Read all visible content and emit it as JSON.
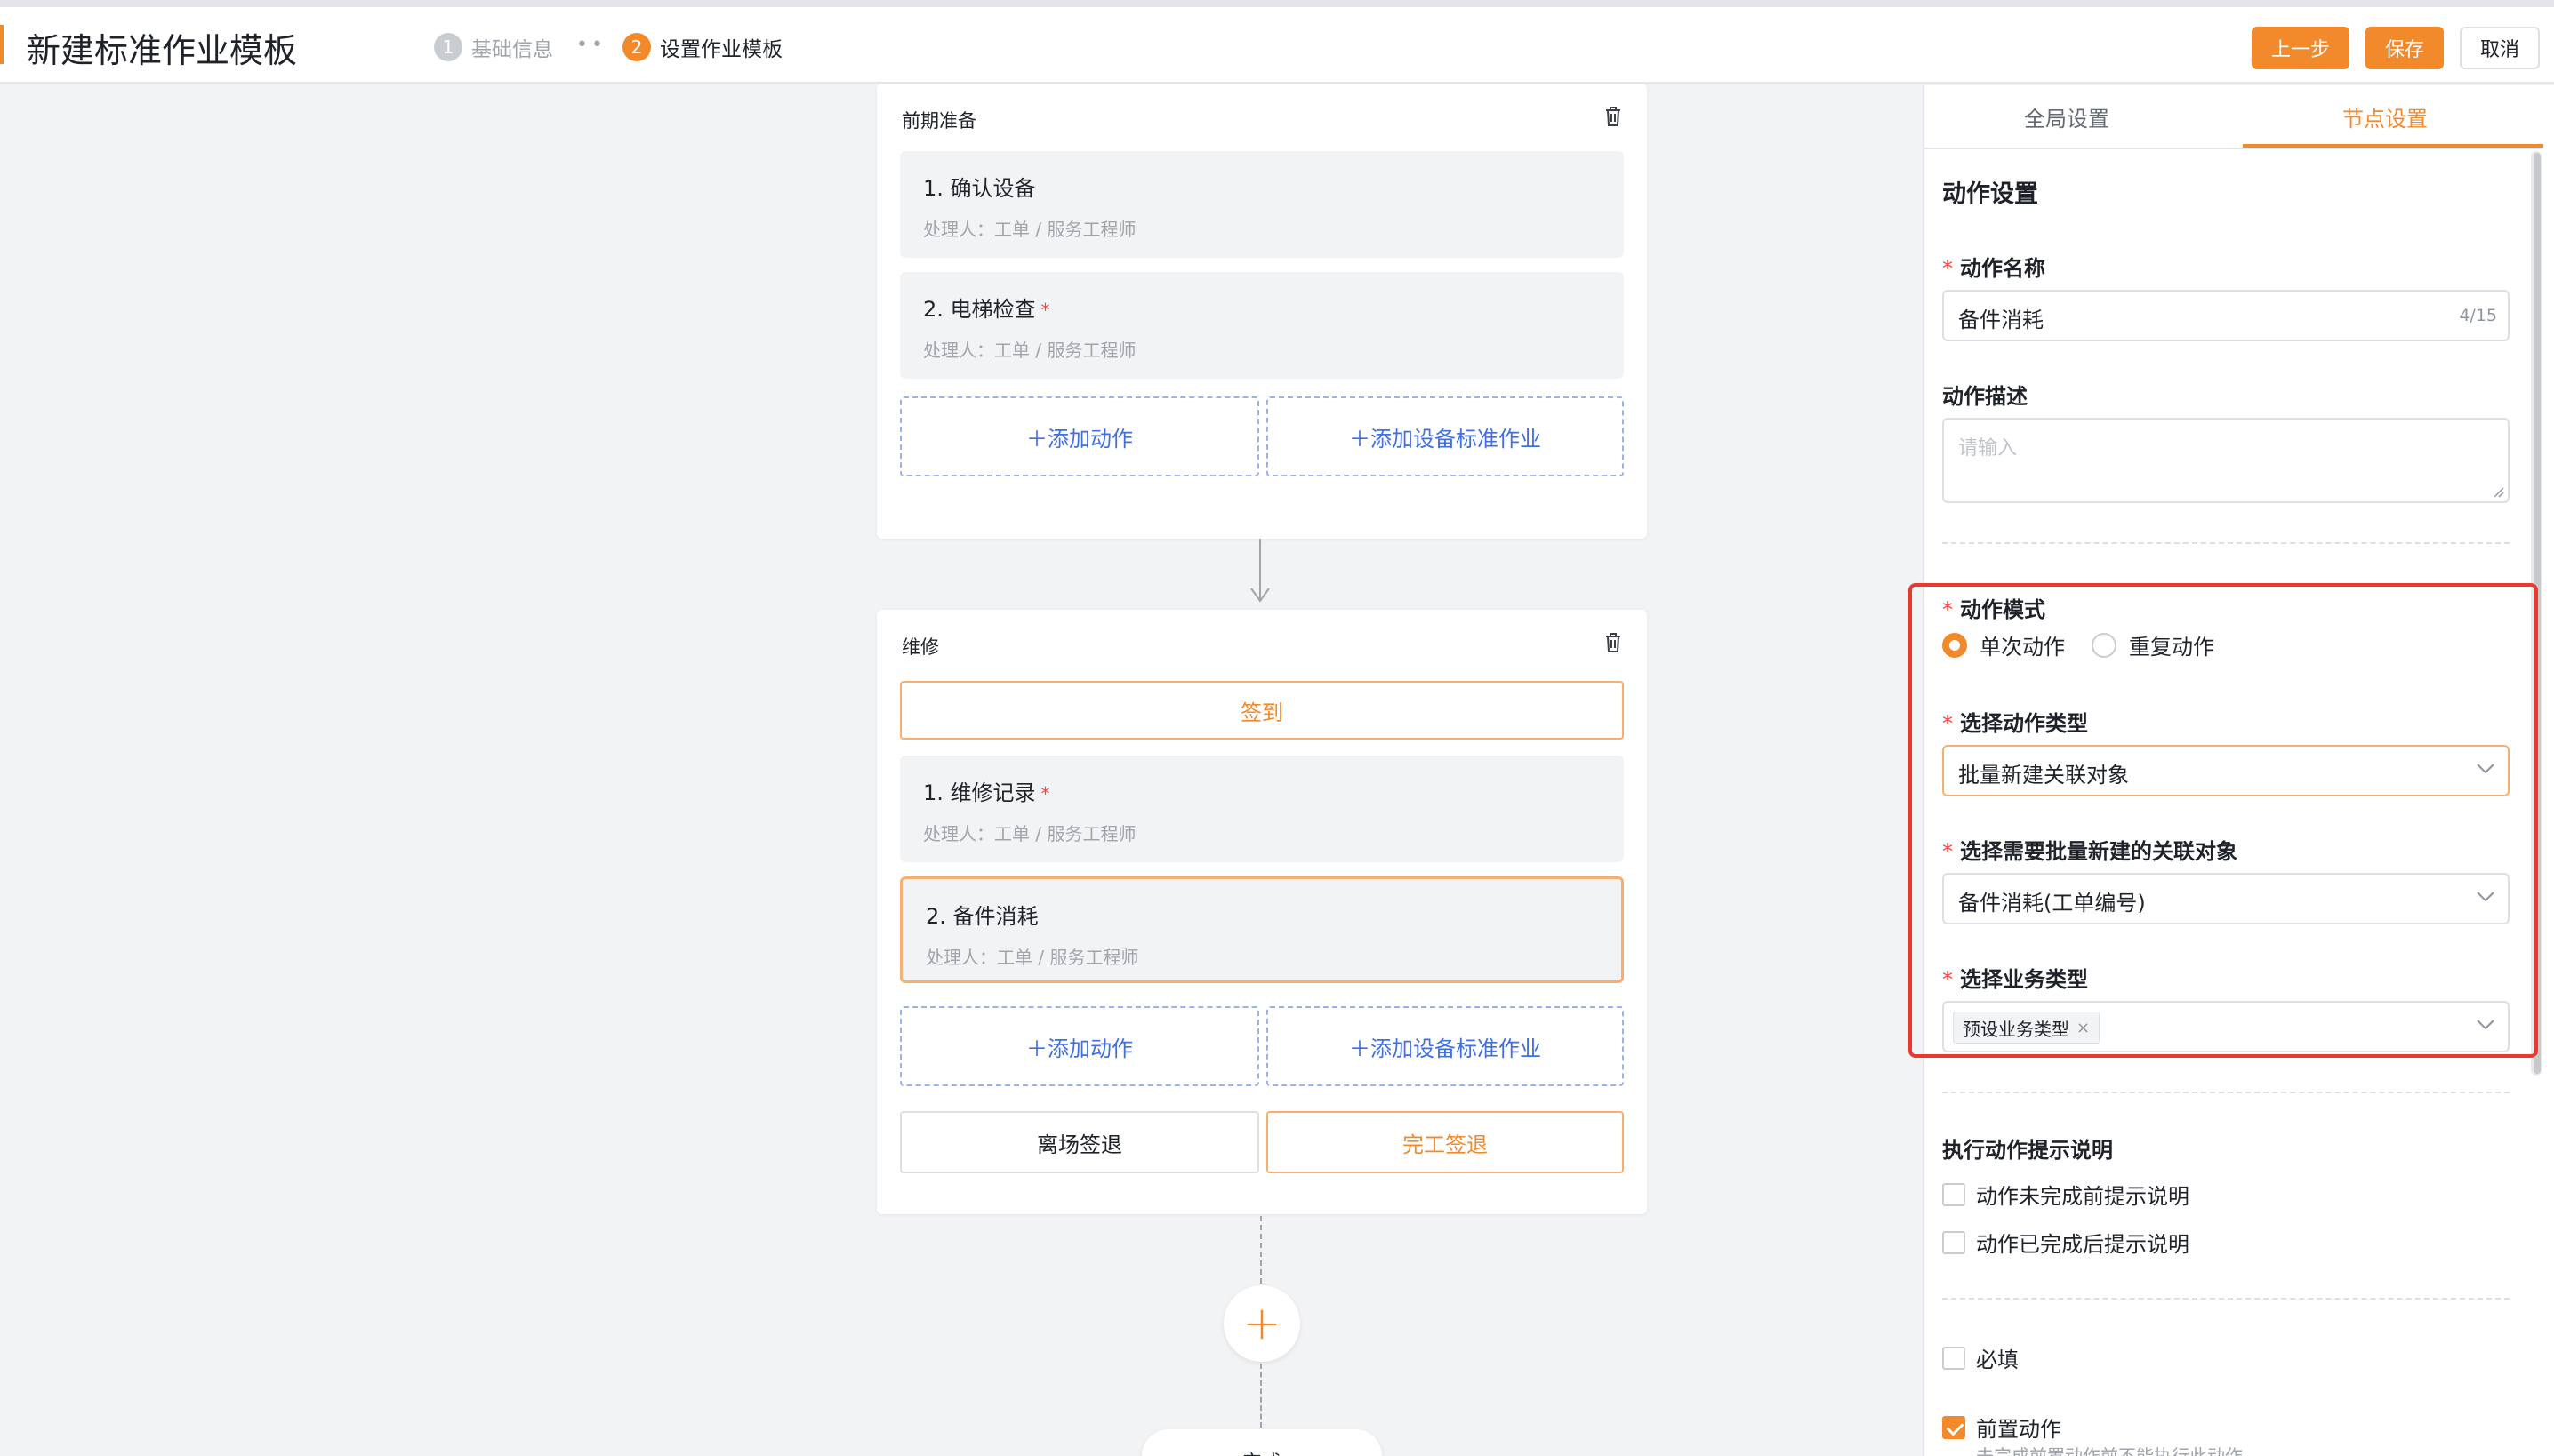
{
  "header": {
    "title": "新建标准作业模板",
    "steps": [
      {
        "num": "1",
        "label": "基础信息"
      },
      {
        "num": "2",
        "label": "设置作业模板"
      }
    ],
    "buttons": {
      "prev": "上一步",
      "save": "保存",
      "cancel": "取消"
    }
  },
  "canvas": {
    "card1": {
      "title": "前期准备",
      "actions": [
        {
          "title": "1. 确认设备",
          "required": "",
          "handler": "处理人：工单 / 服务工程师"
        },
        {
          "title": "2. 电梯检查",
          "required": "*",
          "handler": "处理人：工单 / 服务工程师"
        }
      ],
      "add_action": "＋添加动作",
      "add_standard": "＋添加设备标准作业"
    },
    "card2": {
      "title": "维修",
      "checkin": "签到",
      "actions": [
        {
          "title": "1. 维修记录",
          "required": "*",
          "handler": "处理人：工单 / 服务工程师"
        },
        {
          "title": "2. 备件消耗",
          "required": "",
          "handler": "处理人：工单 / 服务工程师"
        }
      ],
      "add_action": "＋添加动作",
      "add_standard": "＋添加设备标准作业",
      "leave": "离场签退",
      "finish": "完工签退"
    },
    "add_node": "+",
    "end_label": "完成"
  },
  "panel": {
    "tabs": {
      "global": "全局设置",
      "node": "节点设置"
    },
    "section_title": "动作设置",
    "name_label": "动作名称",
    "name_value": "备件消耗",
    "name_counter": "4/15",
    "desc_label": "动作描述",
    "desc_placeholder": "请输入",
    "mode_label": "动作模式",
    "mode_options": [
      "单次动作",
      "重复动作"
    ],
    "mode_selected": "单次动作",
    "type_label": "选择动作类型",
    "type_value": "批量新建关联对象",
    "object_label": "选择需要批量新建的关联对象",
    "object_value": "备件消耗(工单编号)",
    "biz_label": "选择业务类型",
    "biz_tag": "预设业务类型",
    "tip_section": "执行动作提示说明",
    "tip_before": "动作未完成前提示说明",
    "tip_after": "动作已完成后提示说明",
    "required_label": "必填",
    "pre_action_label": "前置动作",
    "pre_action_sub": "未完成前置动作前不能执行此动作"
  },
  "colors": {
    "accent": "#f28a2c",
    "required": "#f5443b",
    "highlight_box": "#e8382f",
    "link": "#3f6fe0"
  }
}
